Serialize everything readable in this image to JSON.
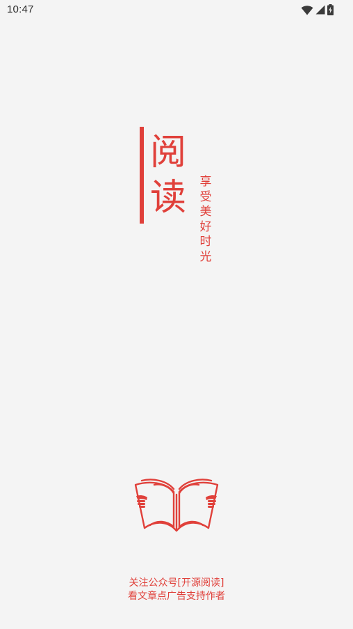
{
  "status_bar": {
    "time": "10:47",
    "icons": [
      "wifi-icon",
      "signal-icon",
      "battery-charging-icon"
    ]
  },
  "app": {
    "title_chars": [
      "阅",
      "读"
    ],
    "slogan_chars": [
      "享",
      "受",
      "美",
      "好",
      "时",
      "光"
    ],
    "logo_icon": "open-book-reader-icon"
  },
  "footer": {
    "line1": "关注公众号[开源阅读]",
    "line2": "看文章点广告支持作者"
  },
  "colors": {
    "accent": "#e0403a",
    "background": "#f4f4f4",
    "status_text": "#2b2b2b"
  }
}
